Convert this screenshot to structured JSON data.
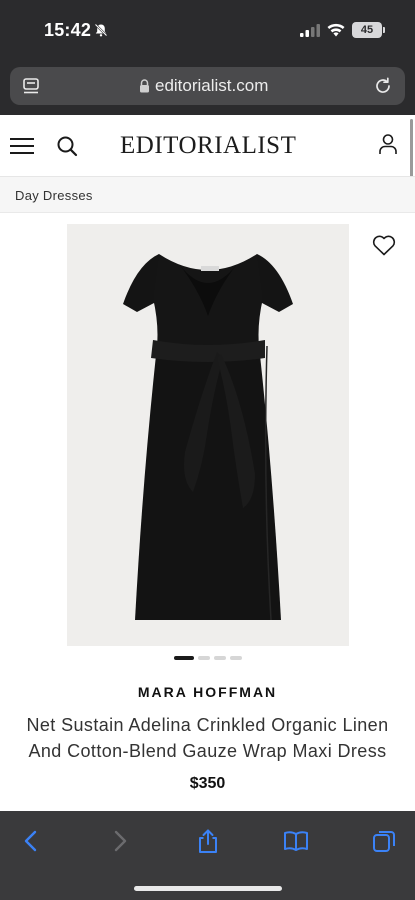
{
  "status_bar": {
    "time": "15:42",
    "battery": "45"
  },
  "browser": {
    "url": "editorialist.com"
  },
  "site": {
    "logo": "EDITORIALIST"
  },
  "breadcrumb": "Day Dresses",
  "product": {
    "brand": "MARA HOFFMAN",
    "name_line1": "Net Sustain Adelina Crinkled Organic Linen",
    "name_line2": "And Cotton-Blend Gauze Wrap Maxi Dress",
    "price": "$350",
    "image_dots": {
      "count": 4,
      "active": 1
    }
  },
  "icons": {
    "menu": "menu-icon",
    "search": "search-icon",
    "account": "account-icon",
    "wishlist": "heart-icon",
    "back": "back-icon",
    "forward": "forward-icon",
    "share": "share-icon",
    "bookmarks": "bookmarks-icon",
    "tabs": "tabs-icon"
  },
  "colors": {
    "toolbar_accent": "#3b82f6",
    "dress": "#141414"
  }
}
